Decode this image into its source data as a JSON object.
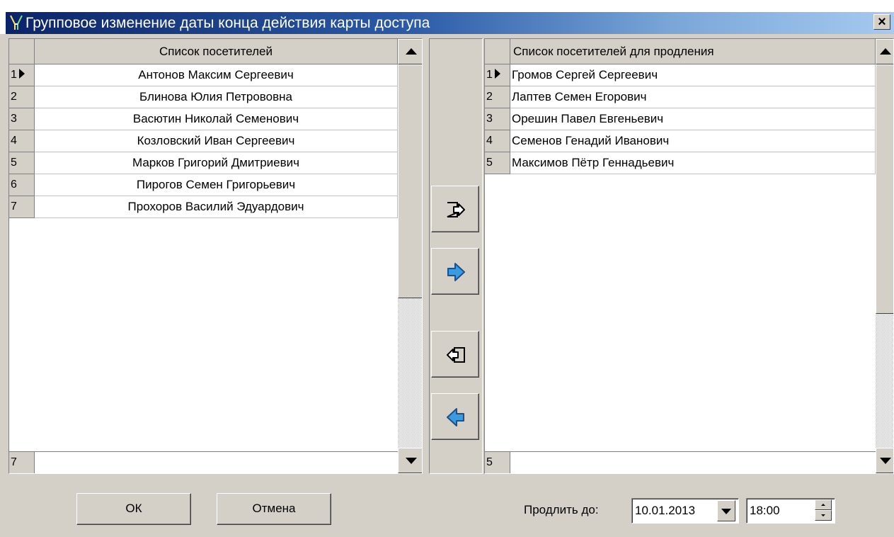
{
  "window": {
    "title": "Групповое изменение даты конца действия карты доступа",
    "close_label": "×"
  },
  "left_grid": {
    "header": "Список посетителей",
    "rows": [
      {
        "index": "1",
        "name": "Антонов Максим Сергеевич"
      },
      {
        "index": "2",
        "name": "Блинова Юлия Петрововна"
      },
      {
        "index": "3",
        "name": "Васютин Николай Семенович"
      },
      {
        "index": "4",
        "name": "Козловский Иван Сергеевич"
      },
      {
        "index": "5",
        "name": "Марков Григорий Дмитриевич"
      },
      {
        "index": "6",
        "name": "Пирогов Семен Григорьевич"
      },
      {
        "index": "7",
        "name": "Прохоров Василий Эдуардович"
      }
    ],
    "footer_count": "7",
    "scroll_fraction": 0.0
  },
  "right_grid": {
    "header": "Список посетителей для продления",
    "rows": [
      {
        "index": "1",
        "name": "Громов Сергей Сергеевич"
      },
      {
        "index": "2",
        "name": "Лаптев Семен Егорович"
      },
      {
        "index": "3",
        "name": "Орешин Павел Евгеньевич"
      },
      {
        "index": "4",
        "name": "Семенов Генадий Иванович"
      },
      {
        "index": "5",
        "name": "Максимов Пётр Геннадьевич"
      }
    ],
    "footer_count": "5"
  },
  "move_buttons": [
    {
      "icon": "move-all-right-icon"
    },
    {
      "icon": "move-right-arrow-icon"
    },
    {
      "icon": "move-all-left-icon"
    },
    {
      "icon": "move-left-arrow-icon"
    }
  ],
  "buttons": {
    "ok": "ОК",
    "cancel": "Отмена"
  },
  "extend": {
    "label": "Продлить до:",
    "date": "10.01.2013",
    "time": "18:00"
  },
  "colors": {
    "title_gradient_start": "#0a246a",
    "title_gradient_end": "#a6caf0",
    "arrow_blue": "#3a9be0",
    "face": "#d4d0c8"
  }
}
